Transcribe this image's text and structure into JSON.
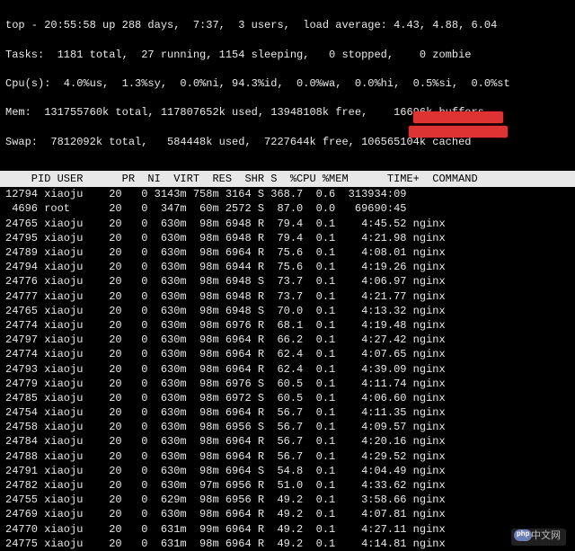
{
  "summary": {
    "line1": "top - 20:55:58 up 288 days,  7:37,  3 users,  load average: 4.43, 4.88, 6.04",
    "line2": "Tasks:  1181 total,  27 running, 1154 sleeping,   0 stopped,    0 zombie",
    "line3": "Cpu(s):  4.0%us,  1.3%sy,  0.0%ni, 94.3%id,  0.0%wa,  0.0%hi,  0.5%si,  0.0%st",
    "line4": "Mem:  131755760k total, 117807652k used, 13948108k free,    16696k buffers",
    "line5": "Swap:  7812092k total,   584448k used,  7227644k free, 106565104k cached"
  },
  "header": {
    "pid": "PID",
    "user": "USER",
    "pr": "PR",
    "ni": "NI",
    "virt": "VIRT",
    "res": "RES",
    "shr": "SHR",
    "s": "S",
    "cpu": "%CPU",
    "mem": "%MEM",
    "time": "TIME+",
    "command": "COMMAND"
  },
  "chart_data": {
    "type": "table",
    "columns": [
      "PID",
      "USER",
      "PR",
      "NI",
      "VIRT",
      "RES",
      "SHR",
      "S",
      "%CPU",
      "%MEM",
      "TIME+",
      "COMMAND"
    ],
    "rows": [
      [
        "12794",
        "xiaoju",
        "20",
        "0",
        "3143m",
        "758m",
        "3164",
        "S",
        "368.7",
        "0.6",
        "313934:09",
        ""
      ],
      [
        "4696",
        "root",
        "20",
        "0",
        "347m",
        "60m",
        "2572",
        "S",
        "87.0",
        "0.0",
        "69690:45",
        ""
      ],
      [
        "24765",
        "xiaoju",
        "20",
        "0",
        "630m",
        "98m",
        "6948",
        "R",
        "79.4",
        "0.1",
        "4:45.52",
        "nginx"
      ],
      [
        "24795",
        "xiaoju",
        "20",
        "0",
        "630m",
        "98m",
        "6948",
        "R",
        "79.4",
        "0.1",
        "4:21.98",
        "nginx"
      ],
      [
        "24789",
        "xiaoju",
        "20",
        "0",
        "630m",
        "98m",
        "6964",
        "R",
        "75.6",
        "0.1",
        "4:08.01",
        "nginx"
      ],
      [
        "24794",
        "xiaoju",
        "20",
        "0",
        "630m",
        "98m",
        "6944",
        "R",
        "75.6",
        "0.1",
        "4:19.26",
        "nginx"
      ],
      [
        "24776",
        "xiaoju",
        "20",
        "0",
        "630m",
        "98m",
        "6948",
        "S",
        "73.7",
        "0.1",
        "4:06.97",
        "nginx"
      ],
      [
        "24777",
        "xiaoju",
        "20",
        "0",
        "630m",
        "98m",
        "6948",
        "R",
        "73.7",
        "0.1",
        "4:21.77",
        "nginx"
      ],
      [
        "24765",
        "xiaoju",
        "20",
        "0",
        "630m",
        "98m",
        "6948",
        "S",
        "70.0",
        "0.1",
        "4:13.32",
        "nginx"
      ],
      [
        "24774",
        "xiaoju",
        "20",
        "0",
        "630m",
        "98m",
        "6976",
        "R",
        "68.1",
        "0.1",
        "4:19.48",
        "nginx"
      ],
      [
        "24797",
        "xiaoju",
        "20",
        "0",
        "630m",
        "98m",
        "6964",
        "R",
        "66.2",
        "0.1",
        "4:27.42",
        "nginx"
      ],
      [
        "24774",
        "xiaoju",
        "20",
        "0",
        "630m",
        "98m",
        "6964",
        "R",
        "62.4",
        "0.1",
        "4:07.65",
        "nginx"
      ],
      [
        "24793",
        "xiaoju",
        "20",
        "0",
        "630m",
        "98m",
        "6964",
        "R",
        "62.4",
        "0.1",
        "4:39.09",
        "nginx"
      ],
      [
        "24779",
        "xiaoju",
        "20",
        "0",
        "630m",
        "98m",
        "6976",
        "S",
        "60.5",
        "0.1",
        "4:11.74",
        "nginx"
      ],
      [
        "24785",
        "xiaoju",
        "20",
        "0",
        "630m",
        "98m",
        "6972",
        "S",
        "60.5",
        "0.1",
        "4:06.60",
        "nginx"
      ],
      [
        "24754",
        "xiaoju",
        "20",
        "0",
        "630m",
        "98m",
        "6964",
        "R",
        "56.7",
        "0.1",
        "4:11.35",
        "nginx"
      ],
      [
        "24758",
        "xiaoju",
        "20",
        "0",
        "630m",
        "98m",
        "6956",
        "S",
        "56.7",
        "0.1",
        "4:09.57",
        "nginx"
      ],
      [
        "24784",
        "xiaoju",
        "20",
        "0",
        "630m",
        "98m",
        "6964",
        "R",
        "56.7",
        "0.1",
        "4:20.16",
        "nginx"
      ],
      [
        "24788",
        "xiaoju",
        "20",
        "0",
        "630m",
        "98m",
        "6964",
        "R",
        "56.7",
        "0.1",
        "4:29.52",
        "nginx"
      ],
      [
        "24791",
        "xiaoju",
        "20",
        "0",
        "630m",
        "98m",
        "6964",
        "S",
        "54.8",
        "0.1",
        "4:04.49",
        "nginx"
      ],
      [
        "24782",
        "xiaoju",
        "20",
        "0",
        "630m",
        "97m",
        "6956",
        "R",
        "51.0",
        "0.1",
        "4:33.62",
        "nginx"
      ],
      [
        "24755",
        "xiaoju",
        "20",
        "0",
        "629m",
        "98m",
        "6956",
        "R",
        "49.2",
        "0.1",
        "3:58.66",
        "nginx"
      ],
      [
        "24769",
        "xiaoju",
        "20",
        "0",
        "630m",
        "98m",
        "6964",
        "R",
        "49.2",
        "0.1",
        "4:07.81",
        "nginx"
      ],
      [
        "24770",
        "xiaoju",
        "20",
        "0",
        "631m",
        "99m",
        "6964",
        "R",
        "49.2",
        "0.1",
        "4:27.11",
        "nginx"
      ],
      [
        "24775",
        "xiaoju",
        "20",
        "0",
        "631m",
        "98m",
        "6964",
        "R",
        "49.2",
        "0.1",
        "4:14.81",
        "nginx"
      ]
    ]
  },
  "watermark": "中文网"
}
